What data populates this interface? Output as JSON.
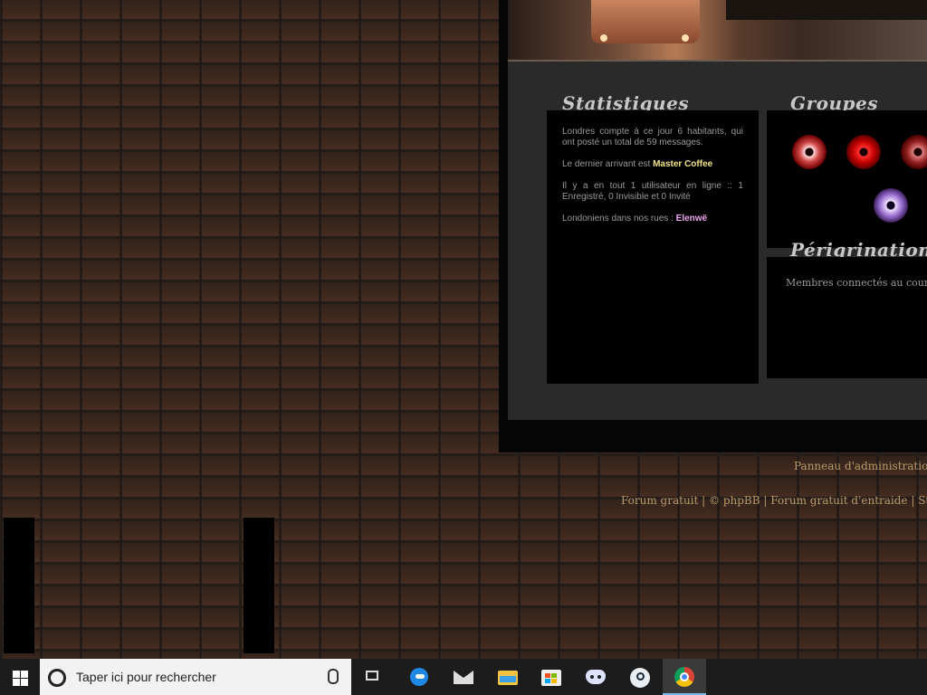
{
  "stats": {
    "title": "Statistiques",
    "line1": "Londres compte à ce jour 6 habitants, qui ont posté un total de 59 messages.",
    "line2_prefix": "Le dernier arrivant est ",
    "newest_member": "Master Coffee",
    "line3": "Il y a en tout 1 utilisateur en ligne :: 1 Enregistré, 0 Invisible et 0 Invité",
    "line4_prefix": "Londoniens dans nos rues : ",
    "online_member": "Elenwë"
  },
  "groups": {
    "title": "Groupes"
  },
  "perigrination": {
    "title": "Périgrination",
    "text": "Membres connectés au cours de"
  },
  "footer": {
    "admin_link": "Panneau d'administration",
    "forum_gratuit": "Forum gratuit",
    "phpbb": "© phpBB",
    "forum_entraide": "Forum gratuit d'entraide",
    "stats_link": "Statist",
    "separator": " | "
  },
  "taskbar": {
    "search_placeholder": "Taper ici pour rechercher",
    "apps": [
      "task-view",
      "edge",
      "mail",
      "file-explorer",
      "store",
      "discord",
      "steam",
      "chrome"
    ]
  },
  "colors": {
    "highlight_yellow": "#f2e38a",
    "highlight_pink": "#f0a6f0",
    "link_gold": "#b89a6a",
    "taskbar": "#1c1c1c"
  }
}
